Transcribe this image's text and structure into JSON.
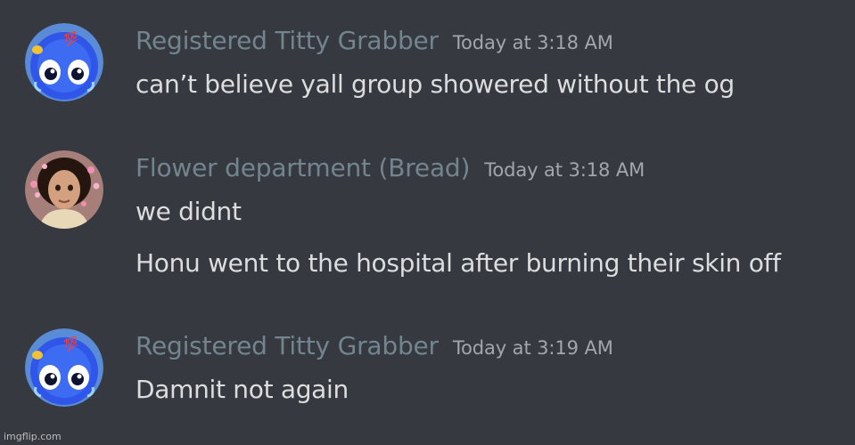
{
  "colors": {
    "background": "#36393f",
    "username": "#72858f",
    "message_text": "#dcddde",
    "timestamp": "#a3a6aa"
  },
  "messages": [
    {
      "author": "Registered Titty Grabber",
      "timestamp": "Today at 3:18 AM",
      "avatar_icon": "blue-emoji-avatar",
      "lines": [
        "can’t believe yall group showered without the og"
      ]
    },
    {
      "author": "Flower department (Bread)",
      "timestamp": "Today at 3:18 AM",
      "avatar_icon": "animated-character-avatar",
      "lines": [
        "we didnt",
        "Honu went to the hospital after burning their skin off"
      ]
    },
    {
      "author": "Registered Titty Grabber",
      "timestamp": "Today at 3:19 AM",
      "avatar_icon": "blue-emoji-avatar",
      "lines": [
        "Damnit not again"
      ]
    }
  ],
  "watermark": "imgflip.com"
}
